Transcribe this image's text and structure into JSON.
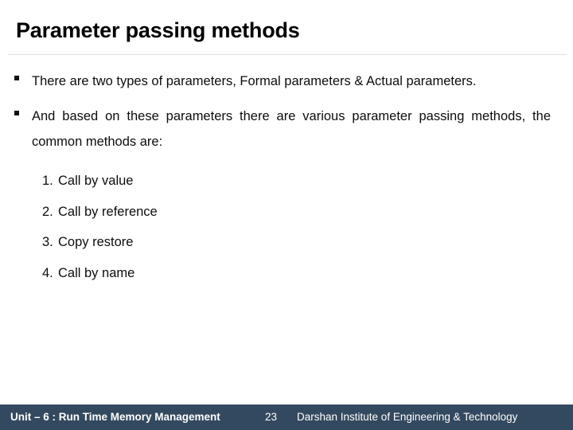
{
  "slide": {
    "title": "Parameter passing methods",
    "bullets": [
      {
        "marker": "square-bullet",
        "text": "There are two types of parameters, Formal parameters & Actual parameters."
      },
      {
        "marker": "square-bullet",
        "text": "And based on these parameters there are various parameter passing methods, the common methods are:"
      }
    ],
    "numbered_list": [
      {
        "number": "1.",
        "text": "Call by value"
      },
      {
        "number": "2.",
        "text": "Call by reference"
      },
      {
        "number": "3.",
        "text": "Copy restore"
      },
      {
        "number": "4.",
        "text": "Call by name"
      }
    ],
    "footer": {
      "unit": "Unit – 6 : Run Time Memory Management",
      "page_number": "23",
      "organization": "Darshan Institute of Engineering & Technology",
      "background_color": "#33495f",
      "text_color": "#ffffff"
    },
    "colors": {
      "background": "#ffffff",
      "title_text": "#000000",
      "body_text": "#0d0d0d",
      "rule": "#e2e2e2"
    }
  }
}
